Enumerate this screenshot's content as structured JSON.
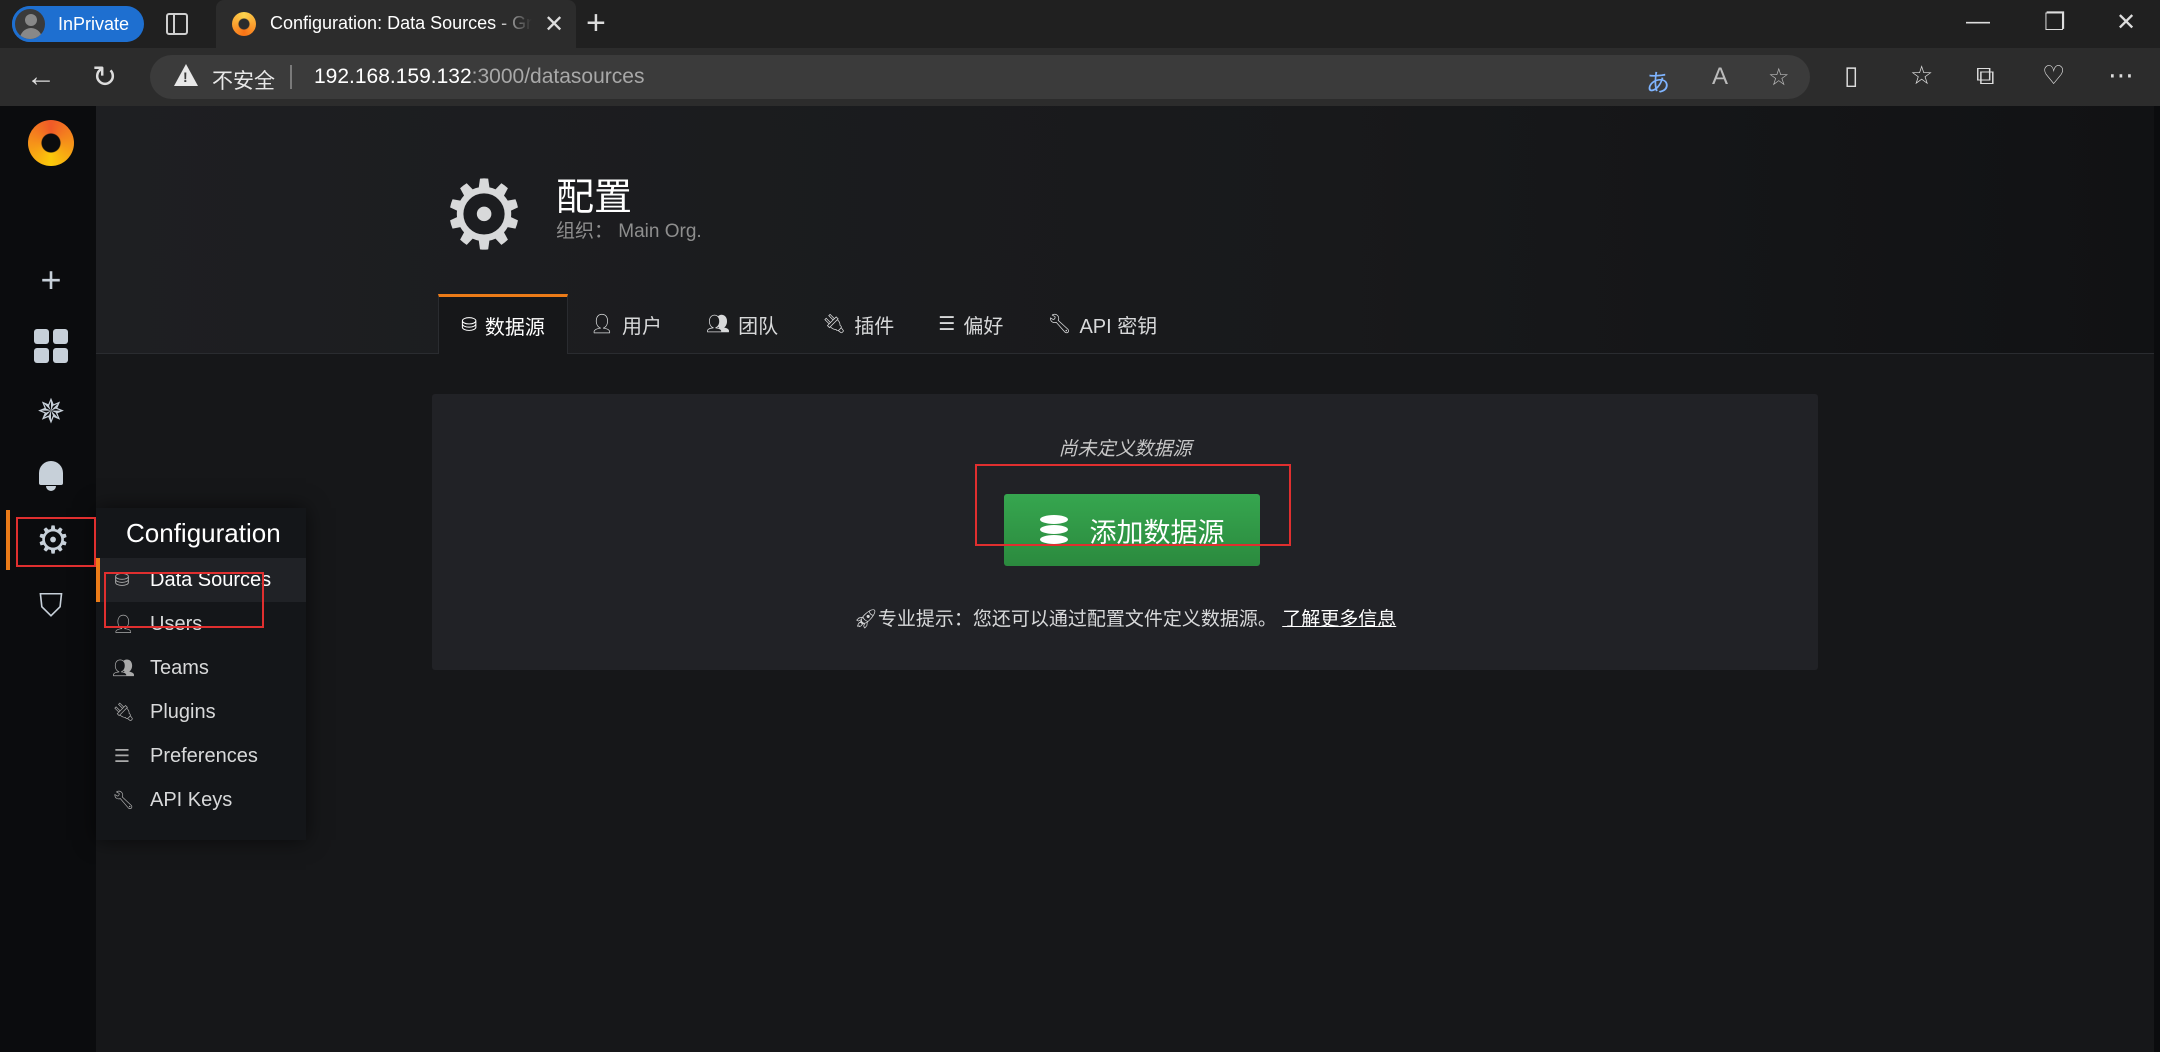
{
  "browser": {
    "inprivate_label": "InPrivate",
    "tab_title": "Configuration: Data Sources - Grafana",
    "security_label": "不安全",
    "url_host": "192.168.159.132",
    "url_path": ":3000/datasources"
  },
  "sidebar": {
    "icons": [
      "plus-icon",
      "dashboards-icon",
      "explore-icon",
      "alerting-icon",
      "configuration-icon",
      "server-admin-icon"
    ]
  },
  "flyout": {
    "title": "Configuration",
    "items": [
      {
        "label": "Data Sources",
        "icon": "database-icon"
      },
      {
        "label": "Users",
        "icon": "user-icon"
      },
      {
        "label": "Teams",
        "icon": "users-icon"
      },
      {
        "label": "Plugins",
        "icon": "plug-icon"
      },
      {
        "label": "Preferences",
        "icon": "sliders-icon"
      },
      {
        "label": "API Keys",
        "icon": "key-icon"
      }
    ]
  },
  "page": {
    "title": "配置",
    "subtitle": "组织： Main Org.",
    "tabs": [
      {
        "label": "数据源",
        "icon": "database-icon"
      },
      {
        "label": "用户",
        "icon": "user-icon"
      },
      {
        "label": "团队",
        "icon": "users-icon"
      },
      {
        "label": "插件",
        "icon": "plug-icon"
      },
      {
        "label": "偏好",
        "icon": "sliders-icon"
      },
      {
        "label": "API 密钥",
        "icon": "key-icon"
      }
    ]
  },
  "content": {
    "empty_text": "尚未定义数据源",
    "add_button": "添加数据源",
    "tip_text": "专业提示：您还可以通过配置文件定义数据源。",
    "tip_link": "了解更多信息"
  },
  "colors": {
    "accent": "#eb7b18",
    "button_green": "#2b8a3e",
    "highlight_red": "#e02f2f",
    "browser_blue": "#1e6fd0"
  }
}
